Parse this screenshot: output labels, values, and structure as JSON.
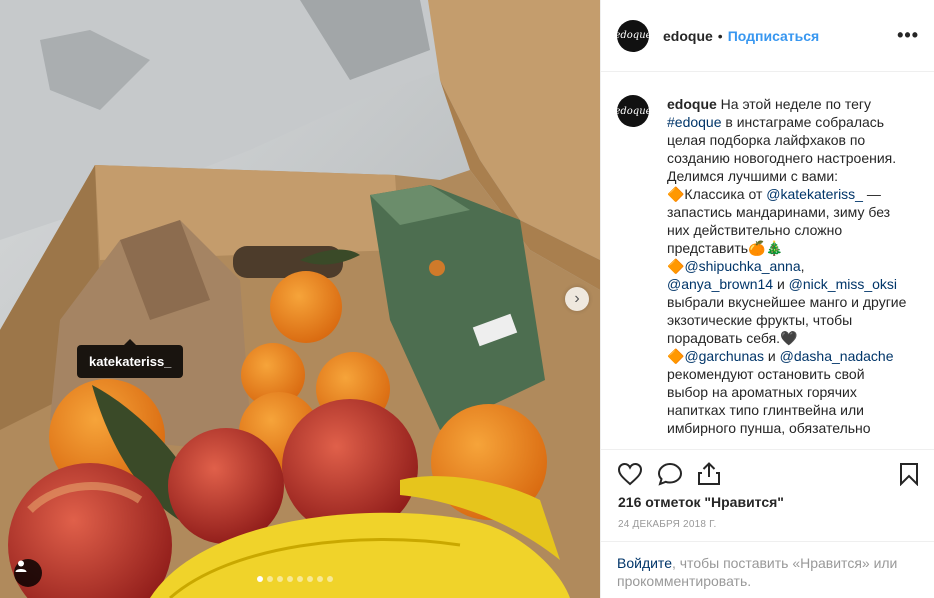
{
  "post": {
    "image_tag": "katekateriss_",
    "carousel": {
      "count": 8,
      "active": 1
    }
  },
  "header": {
    "username": "edoque",
    "separator": "•",
    "follow": "Подписаться",
    "avatar_text": "edoque",
    "more": "•••"
  },
  "caption": {
    "username": "edoque",
    "line1": " На этой неделе по тегу ",
    "hashtag": "#edoque",
    "line2": " в инстаграме собралась целая подборка лайфхаков по созданию новогоднего настроения. Делимся лучшими с вами:\n🔶Классика от ",
    "mention1": "@katekateriss_",
    "line3": " — запастись мандаринами, зиму без них действительно сложно представить🍊🎄\n🔶",
    "mention2": "@shipuchka_anna",
    "line4": ", ",
    "mention3": "@anya_brown14",
    "line5": " и ",
    "mention4": "@nick_miss_oksi",
    "line6": " выбрали вкуснейшее манго и другие экзотические фрукты, чтобы порадовать себя.🖤\n🔶",
    "mention5": "@garchunas",
    "line7": " и ",
    "mention6": "@dasha_nadache",
    "line8": " рекомендуют остановить свой выбор на ароматных горячих напитках типо глинтвейна или имбирного пунша, обязательно"
  },
  "likes": "216 отметок \"Нравится\"",
  "date": "24 ДЕКАБРЯ 2018 Г.",
  "comment": {
    "login_link": "Войдите",
    "text": ", чтобы поставить «Нравится» или прокомментировать."
  }
}
